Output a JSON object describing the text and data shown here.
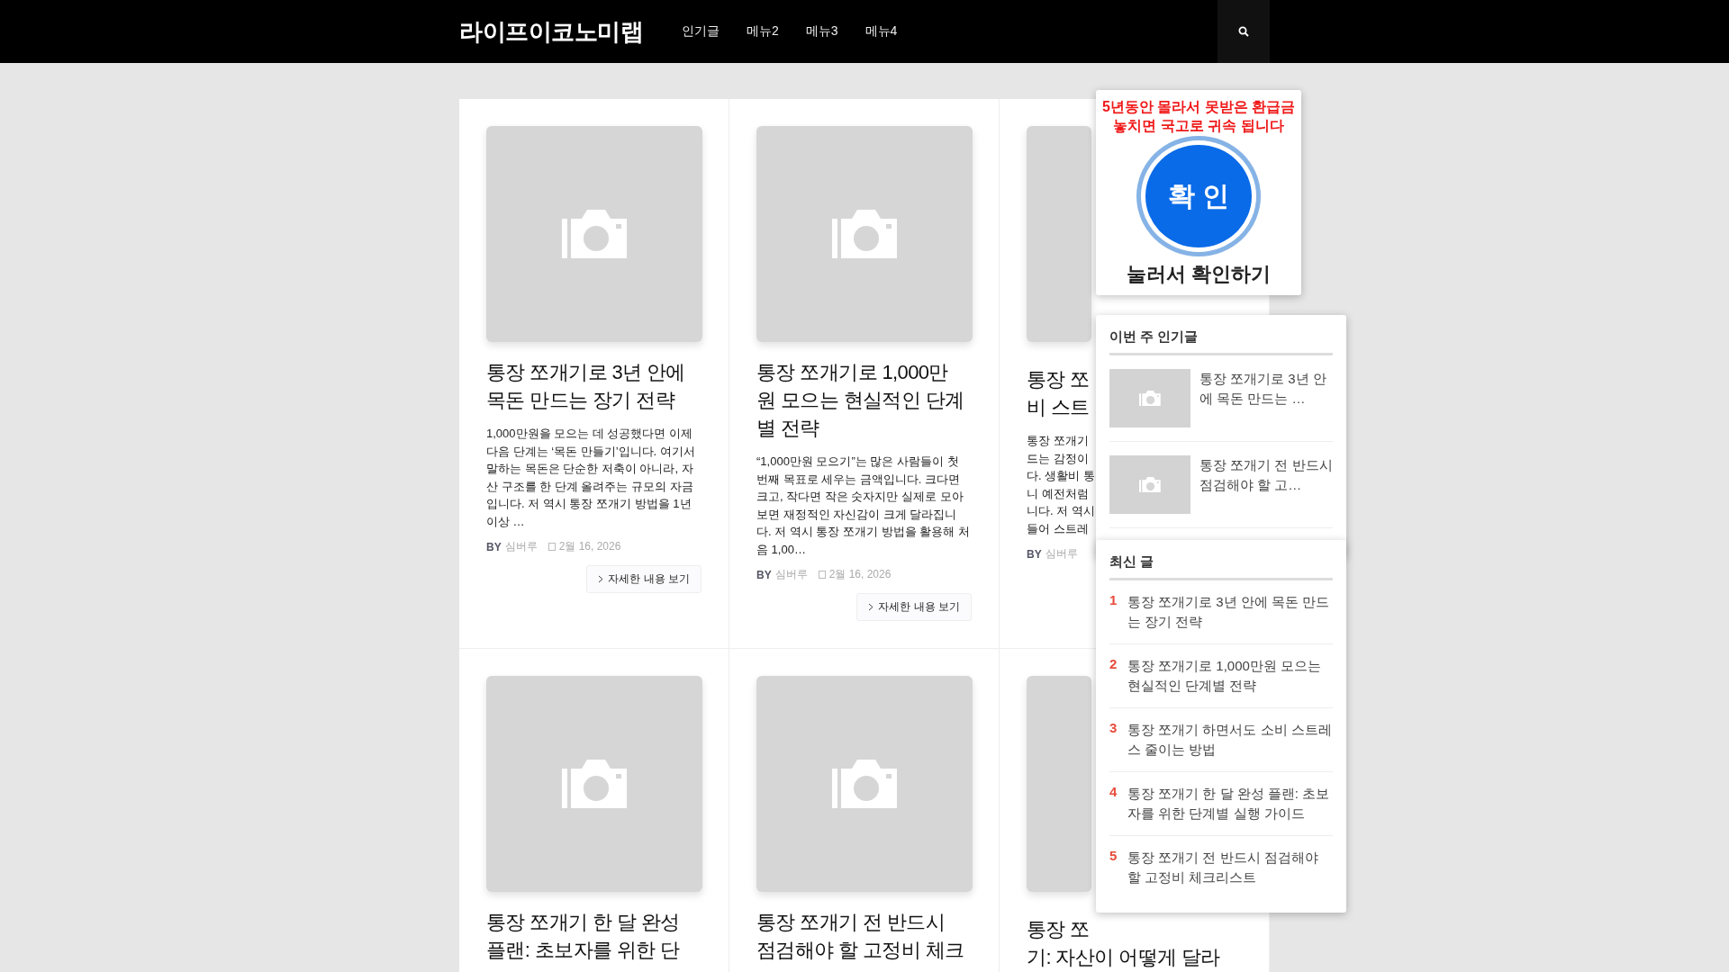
{
  "header": {
    "logo": "라이프이코노미랩",
    "nav": [
      "인기글",
      "메뉴2",
      "메뉴3",
      "메뉴4"
    ]
  },
  "posts": [
    {
      "title_lines": [
        "통장 쪼개기로 3년 안에",
        "목돈 만드는 장기 전략"
      ],
      "excerpt": "1,000만원을 모으는 데 성공했다면 이제 다음 단계는 ‘목돈 만들기’입니다. 여기서 말하는 목돈은 단순한 저축이 아니라, 자산 구조를 한 단계 올려주는 규모의 자금입니다. 저 역시 통장 쪼개기 방법을 1년 이상 …",
      "by": "BY",
      "author": "심버루",
      "date": "2월 16, 2026",
      "more": "자세한 내용 보기"
    },
    {
      "title_lines": [
        "통장 쪼개기로 1,000만",
        "원 모으는 현실적인 단계",
        "별 전략"
      ],
      "excerpt": "“1,000만원 모으기”는 많은 사람들이 첫 번째 목표로 세우는 금액입니다. 크다면 크고, 작다면 작은 숫자지만 실제로 모아보면 재정적인 자신감이 크게 달라집니다. 저 역시 통장 쪼개기 방법을 활용해 처음 1,00…",
      "by": "BY",
      "author": "심버루",
      "date": "2월 16, 2026",
      "more": "자세한 내용 보기"
    },
    {
      "kind": "partial",
      "title_lines": [
        "통장 쪼",
        "비 스트"
      ],
      "excerpt_lines": [
        "통장 쪼개기",
        "드는 감정이",
        "다. 생활비 통",
        "니 예전처럼",
        "니다. 저 역시",
        "들어 스트레"
      ],
      "by": "BY",
      "author": "심버루"
    },
    {
      "title_lines": [
        "통장 쪼개기 한 달 완성",
        "플랜: 초보자를 위한 단"
      ]
    },
    {
      "title_lines": [
        "통장 쪼개기 전 반드시",
        "점검해야 할 고정비 체크"
      ]
    },
    {
      "kind": "partial",
      "title_lines": [
        "통장 쪼",
        "기: 자산이 어떻게 달라"
      ]
    }
  ],
  "ad": {
    "headline_lines": [
      "5년동안 몰라서 못받은 환급금",
      "놓치면 국고로 귀속 됩니다"
    ],
    "button": "확 인",
    "caption": "눌러서 확인하기"
  },
  "popular": {
    "title": "이번 주 인기글",
    "items": [
      {
        "title": "통장 쪼개기로 3년 안에 목돈 만드는 …"
      },
      {
        "title": "통장 쪼개기 전 반드시 점검해야 할 고…"
      }
    ]
  },
  "recent": {
    "title": "최신 글",
    "items": [
      {
        "rank": "1",
        "title": "통장 쪼개기로 3년 안에 목돈 만드는 장기 전략"
      },
      {
        "rank": "2",
        "title": "통장 쪼개기로 1,000만원 모으는 현실적인 단계별 전략"
      },
      {
        "rank": "3",
        "title": "통장 쪼개기 하면서도 소비 스트레스 줄이는 방법"
      },
      {
        "rank": "4",
        "title": "통장 쪼개기 한 달 완성 플랜: 초보자를 위한 단계별 실행 가이드"
      },
      {
        "rank": "5",
        "title": "통장 쪼개기 전 반드시 점검해야 할 고정비 체크리스트"
      }
    ]
  }
}
